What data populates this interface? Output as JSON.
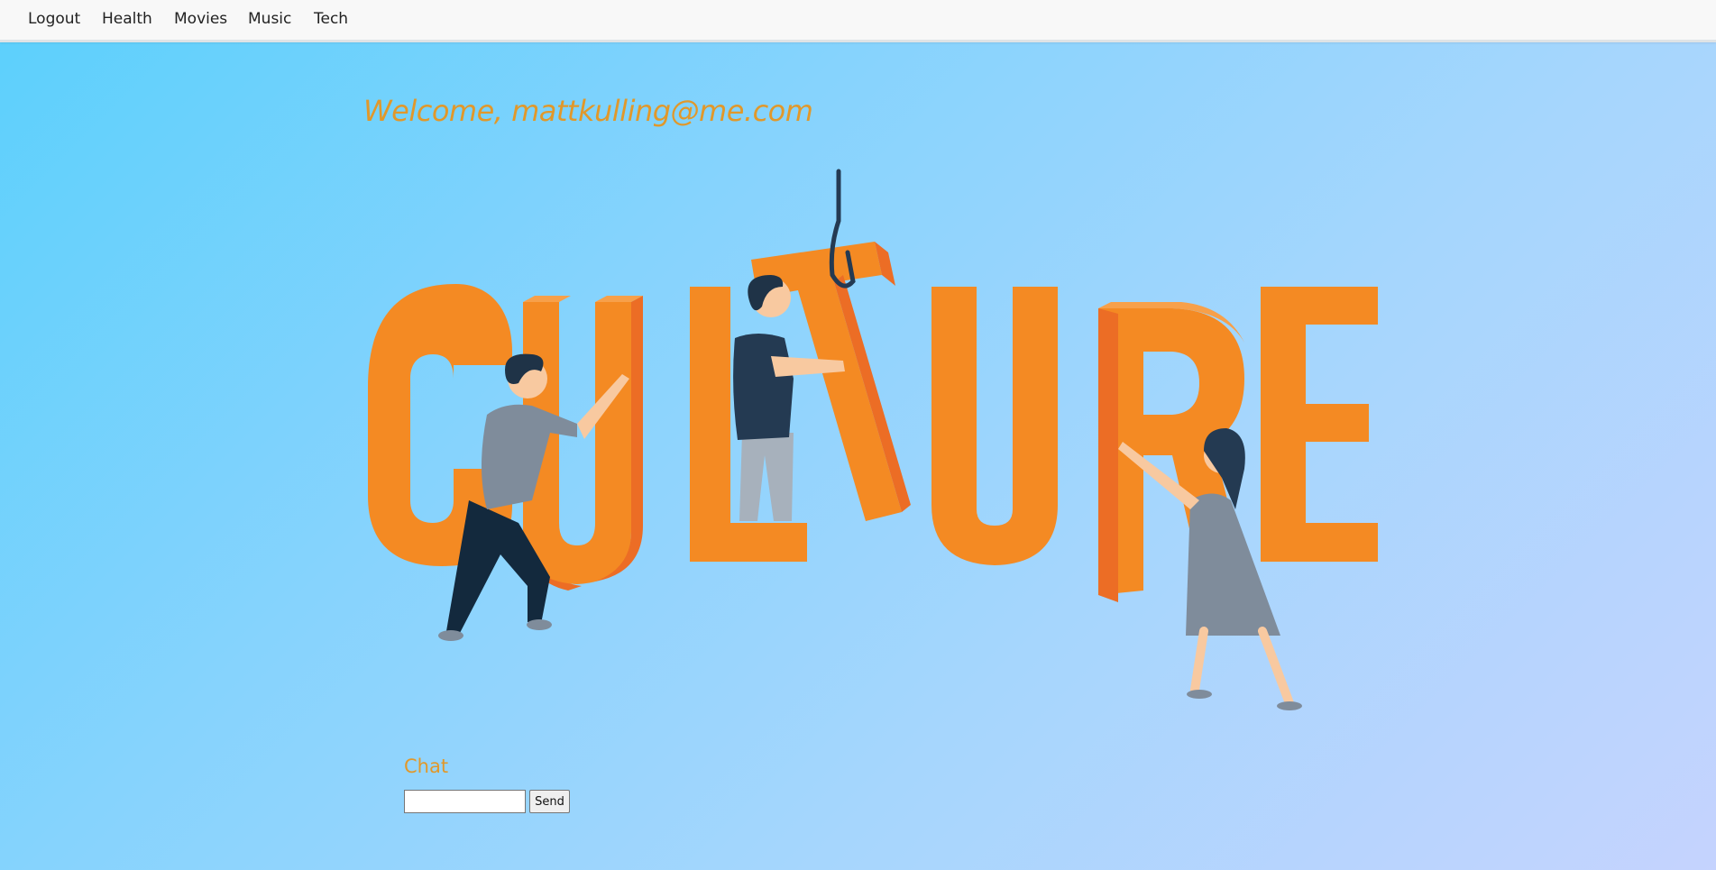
{
  "nav": {
    "items": [
      {
        "label": "Logout"
      },
      {
        "label": "Health"
      },
      {
        "label": "Movies"
      },
      {
        "label": "Music"
      },
      {
        "label": "Tech"
      }
    ]
  },
  "welcome": {
    "text": "Welcome, mattkulling@me.com"
  },
  "hero": {
    "word": "CULTURE",
    "letter_color": "#f48a23",
    "shadow_color": "#ec6d25"
  },
  "chat": {
    "title": "Chat",
    "input_value": "",
    "send_label": "Send"
  },
  "colors": {
    "accent": "#e1982a",
    "navbar_bg": "#f8f8f8"
  }
}
